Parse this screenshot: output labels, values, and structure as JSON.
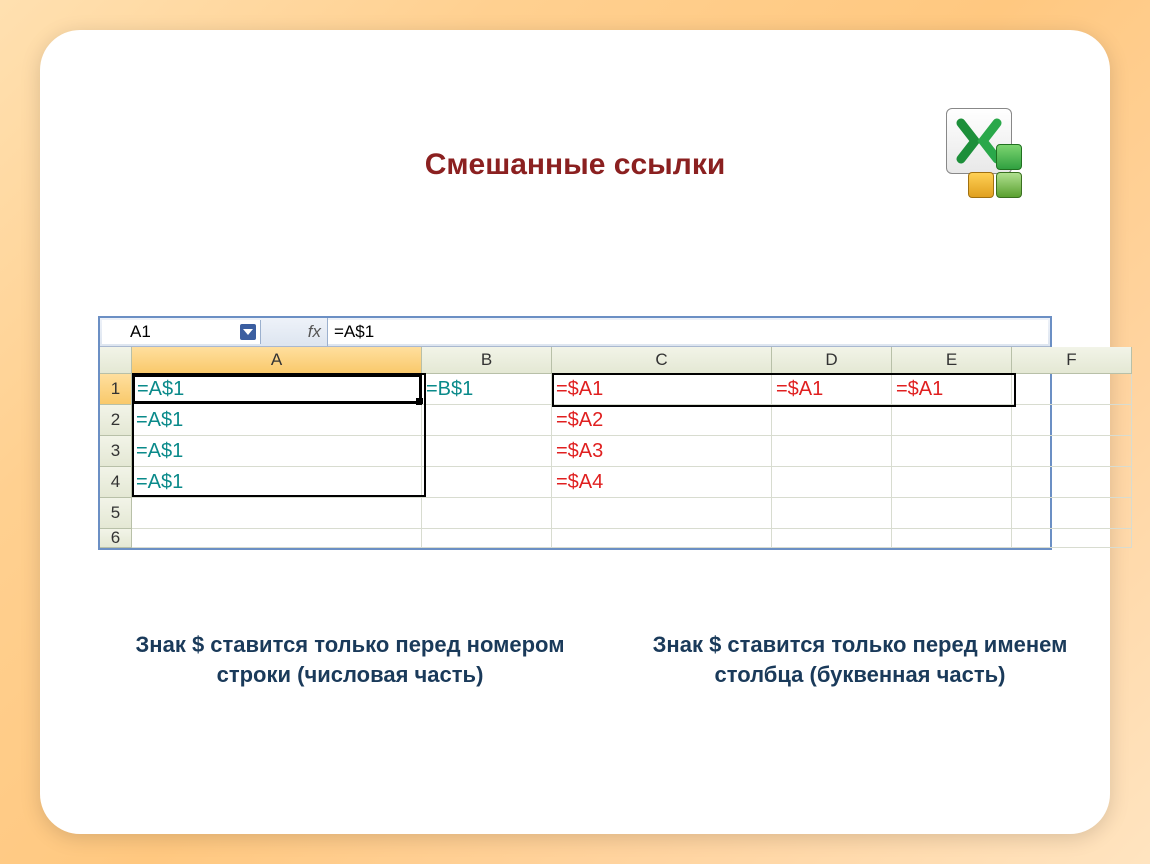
{
  "title": "Смешанные ссылки",
  "icon": "excel-icon",
  "formula_bar": {
    "name_box": "A1",
    "fx_label": "fx",
    "formula": "=A$1"
  },
  "columns": [
    "",
    "A",
    "B",
    "C",
    "D",
    "E",
    "F"
  ],
  "rows": [
    "1",
    "2",
    "3",
    "4",
    "5",
    "6"
  ],
  "cells": {
    "A1": {
      "v": "=A$1",
      "color": "teal"
    },
    "B1": {
      "v": "=B$1",
      "color": "teal"
    },
    "C1": {
      "v": "=$A1",
      "color": "red"
    },
    "D1": {
      "v": "=$A1",
      "color": "red"
    },
    "E1": {
      "v": "=$A1",
      "color": "red"
    },
    "A2": {
      "v": "=A$1",
      "color": "teal"
    },
    "C2": {
      "v": "=$A2",
      "color": "red"
    },
    "A3": {
      "v": "=A$1",
      "color": "teal"
    },
    "C3": {
      "v": "=$A3",
      "color": "red"
    },
    "A4": {
      "v": "=A$1",
      "color": "teal"
    },
    "C4": {
      "v": "=$A4",
      "color": "red"
    }
  },
  "caption_left": "Знак $ ставится только перед номером строки (числовая часть)",
  "caption_right": "Знак $ ставится только перед именем столбца (буквенная часть)"
}
